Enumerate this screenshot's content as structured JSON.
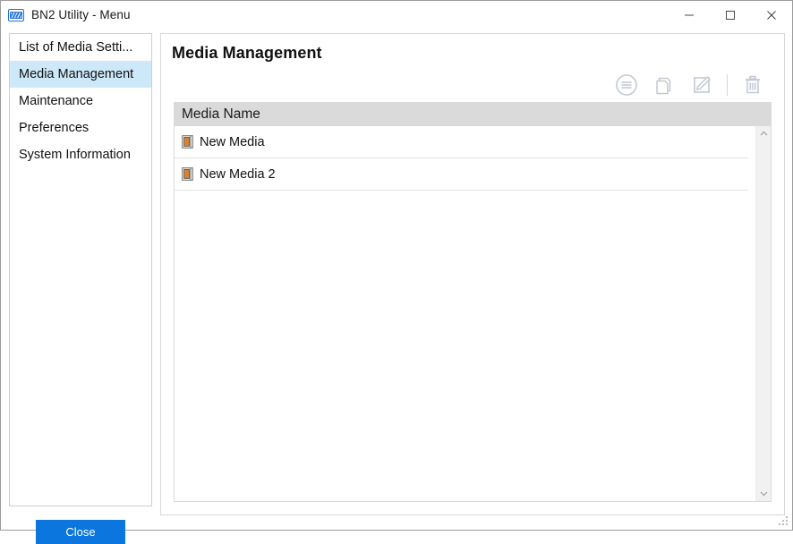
{
  "window": {
    "title": "BN2 Utility - Menu",
    "icon": "app-icon",
    "controls": {
      "minimize": "minimize-icon",
      "maximize": "maximize-icon",
      "close": "close-icon"
    }
  },
  "sidebar": {
    "items": [
      {
        "label": "List of Media Setti...",
        "selected": false
      },
      {
        "label": "Media Management",
        "selected": true
      },
      {
        "label": "Maintenance",
        "selected": false
      },
      {
        "label": "Preferences",
        "selected": false
      },
      {
        "label": "System Information",
        "selected": false
      }
    ],
    "close_button": "Close"
  },
  "main": {
    "title": "Media Management",
    "toolbar": [
      {
        "name": "details-icon",
        "title": "Details"
      },
      {
        "name": "copy-icon",
        "title": "Copy"
      },
      {
        "name": "edit-icon",
        "title": "Edit"
      },
      {
        "name": "delete-icon",
        "title": "Delete"
      }
    ],
    "list": {
      "columns": [
        "Media Name"
      ],
      "rows": [
        {
          "name": "New Media",
          "icon": "media-icon"
        },
        {
          "name": "New Media 2",
          "icon": "media-icon"
        }
      ]
    },
    "scrollbar": {
      "up": "chevron-up-icon",
      "down": "chevron-down-icon"
    }
  },
  "colors": {
    "accent": "#0b76dd",
    "selection": "#cde8f9",
    "header_bg": "#dadada",
    "icon_gray": "#c3c9d4"
  }
}
